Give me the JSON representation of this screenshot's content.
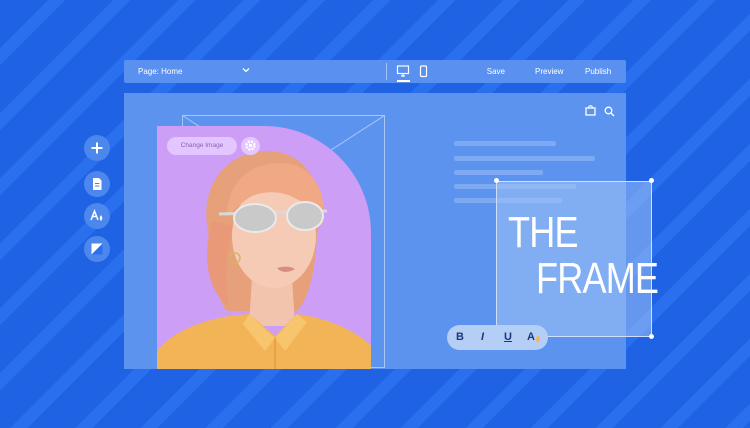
{
  "topbar": {
    "page_label": "Page: Home",
    "save_label": "Save",
    "preview_label": "Preview",
    "publish_label": "Publish",
    "icons": [
      "chevron-down-icon",
      "desktop-icon",
      "mobile-icon"
    ]
  },
  "canvas": {
    "icons": [
      "shopping-bag-icon",
      "search-icon"
    ],
    "photo_badge_label": "Change Image",
    "headline_line1": "THE",
    "headline_line2": "FRAME"
  },
  "format_toolbar": {
    "bold": "B",
    "italic": "I",
    "underline": "U",
    "text_color": "A"
  },
  "sidebar": {
    "items": [
      "add-icon",
      "page-icon",
      "design-icon",
      "media-icon"
    ]
  },
  "colors": {
    "background": "#1f63e4",
    "canvas": "#5b93ee",
    "photo_card": "#cc9ef6",
    "sweater": "#f3b457"
  }
}
